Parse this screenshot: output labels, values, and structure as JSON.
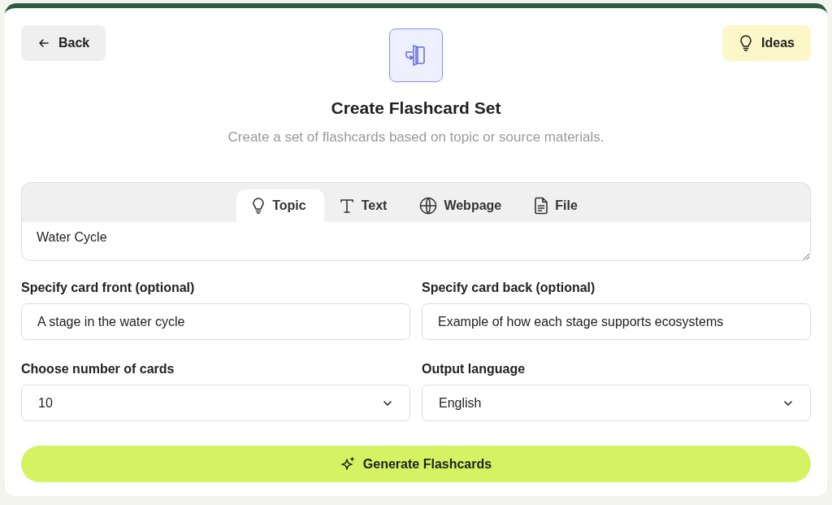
{
  "header": {
    "back_button": "Back",
    "ideas_button": "Ideas",
    "title": "Create Flashcard Set",
    "subtitle": "Create a set of flashcards based on topic or source materials."
  },
  "source_tabs": [
    {
      "label": "Topic",
      "kind": "topic",
      "selected": true
    },
    {
      "label": "Text",
      "kind": "text",
      "selected": false
    },
    {
      "label": "Webpage",
      "kind": "webpage",
      "selected": false
    },
    {
      "label": "File",
      "kind": "file",
      "selected": false
    }
  ],
  "topic_input": {
    "value": "Water Cycle"
  },
  "card_front": {
    "label": "Specify card front (optional)",
    "value": "A stage in the water cycle"
  },
  "card_back": {
    "label": "Specify card back (optional)",
    "value": "Example of how each stage supports ecosystems"
  },
  "number_of_cards": {
    "label": "Choose number of cards",
    "value": "10"
  },
  "output_language": {
    "label": "Output language",
    "value": "English"
  },
  "generate_button": "Generate Flashcards"
}
